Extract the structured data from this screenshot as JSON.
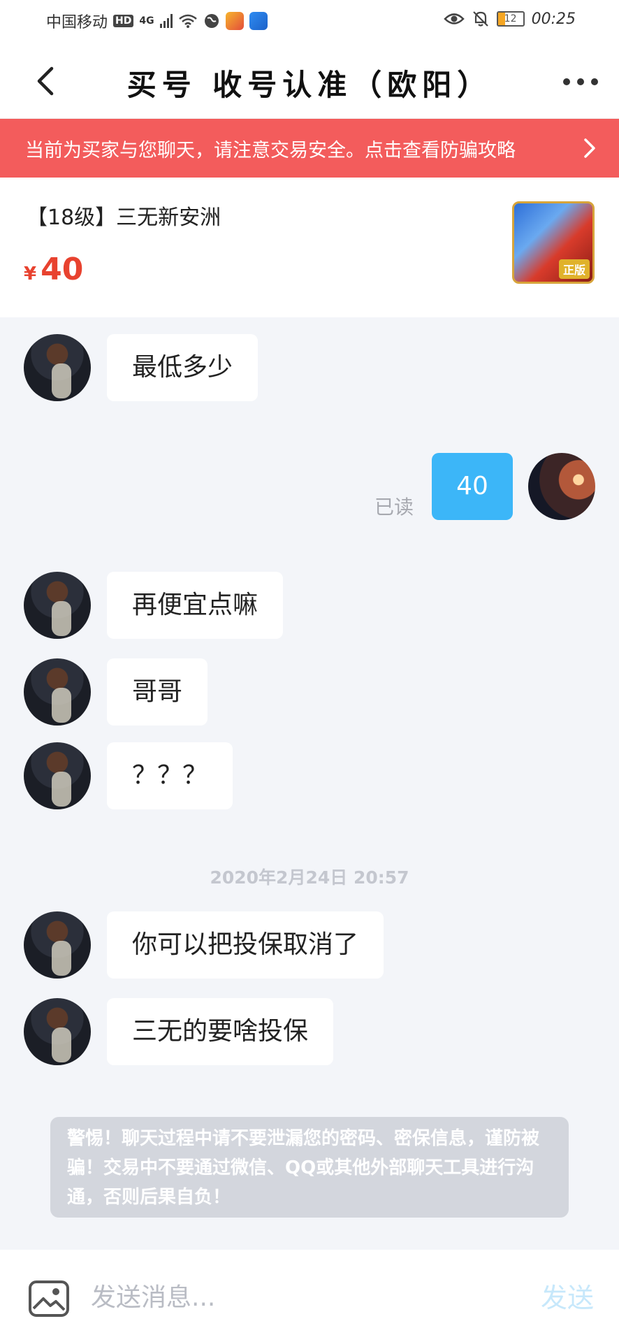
{
  "status_bar": {
    "carrier": "中国移动",
    "hd": "HD",
    "network": "4G",
    "battery": "12",
    "time": "00:25"
  },
  "nav": {
    "title": "买号  收号认准（欧阳）"
  },
  "banner": {
    "text": "当前为买家与您聊天，请注意交易安全。点击查看防骗攻略"
  },
  "product": {
    "title": "【18级】三无新安洲",
    "currency": "¥",
    "price": "40",
    "thumb_badge": "正版"
  },
  "chat": {
    "messages": [
      {
        "from": "other",
        "text": "最低多少"
      },
      {
        "from": "self",
        "text": "40",
        "status": "已读"
      },
      {
        "from": "other",
        "text": "再便宜点嘛"
      },
      {
        "from": "other",
        "text": "哥哥"
      },
      {
        "from": "other",
        "text": "？？？"
      },
      {
        "from": "other",
        "text": "你可以把投保取消了"
      },
      {
        "from": "other",
        "text": "三无的要啥投保"
      }
    ],
    "timestamp": "2020年2月24日 20:57"
  },
  "notice": {
    "text": "警惕！聊天过程中请不要泄漏您的密码、密保信息，谨防被骗！交易中不要通过微信、QQ或其他外部聊天工具进行沟通，否则后果自负！"
  },
  "input": {
    "placeholder": "发送消息...",
    "send_label": "发送"
  },
  "colors": {
    "banner": "#f35c5c",
    "price": "#e8422f",
    "self_bubble": "#3cb6f8",
    "send_disabled": "#c7e8fb"
  }
}
